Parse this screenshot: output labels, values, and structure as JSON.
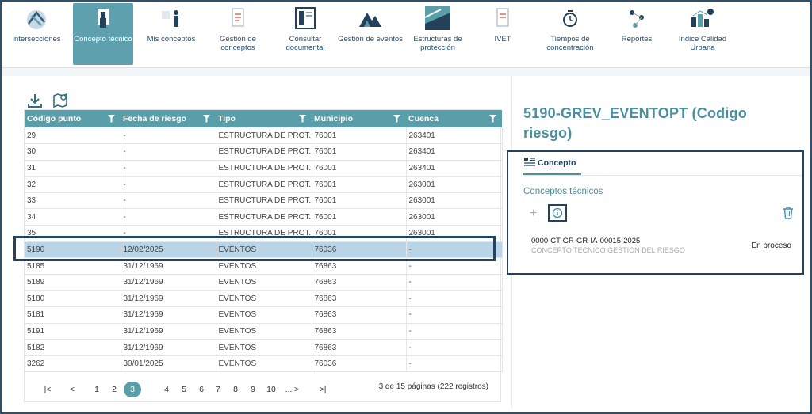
{
  "nav": {
    "items": [
      {
        "label": "Intersecciones",
        "icon": "intersections-icon"
      },
      {
        "label": "Concepto técnico",
        "icon": "technical-concept-icon",
        "active": true
      },
      {
        "label": "Mis conceptos",
        "icon": "my-concepts-icon"
      },
      {
        "label": "Gestión de conceptos",
        "icon": "concept-management-icon"
      },
      {
        "label": "Consultar documental",
        "icon": "document-query-icon"
      },
      {
        "label": "Gestión de eventos",
        "icon": "event-management-icon"
      },
      {
        "label": "Estructuras de protección",
        "icon": "protection-structures-icon"
      },
      {
        "label": "IVET",
        "icon": "ivet-icon"
      },
      {
        "label": "Tiempos de concentración",
        "icon": "concentration-times-icon"
      },
      {
        "label": "Reportes",
        "icon": "reports-icon"
      },
      {
        "label": "Indice Calidad Urbana",
        "icon": "urban-quality-icon"
      }
    ]
  },
  "toolbar": {
    "download_icon": "download-icon",
    "map_icon": "map-edit-icon"
  },
  "table": {
    "columns": [
      "Código punto",
      "Fecha de riesgo",
      "Tipo",
      "Municipio",
      "Cuenca"
    ],
    "rows": [
      [
        "29",
        "-",
        "ESTRUCTURA DE PROT...",
        "76001",
        "263401"
      ],
      [
        "30",
        "-",
        "ESTRUCTURA DE PROT...",
        "76001",
        "263401"
      ],
      [
        "31",
        "-",
        "ESTRUCTURA DE PROT...",
        "76001",
        "263401"
      ],
      [
        "32",
        "-",
        "ESTRUCTURA DE PROT...",
        "76001",
        "263001"
      ],
      [
        "33",
        "-",
        "ESTRUCTURA DE PROT...",
        "76001",
        "263001"
      ],
      [
        "34",
        "-",
        "ESTRUCTURA DE PROT...",
        "76001",
        "263001"
      ],
      [
        "35",
        "-",
        "ESTRUCTURA DE PROT...",
        "76001",
        "263001"
      ],
      [
        "5190",
        "12/02/2025",
        "EVENTOS",
        "76036",
        "-"
      ],
      [
        "5185",
        "31/12/1969",
        "EVENTOS",
        "76863",
        "-"
      ],
      [
        "5189",
        "31/12/1969",
        "EVENTOS",
        "76863",
        "-"
      ],
      [
        "5180",
        "31/12/1969",
        "EVENTOS",
        "76863",
        "-"
      ],
      [
        "5181",
        "31/12/1969",
        "EVENTOS",
        "76863",
        "-"
      ],
      [
        "5191",
        "31/12/1969",
        "EVENTOS",
        "76863",
        "-"
      ],
      [
        "5182",
        "31/12/1969",
        "EVENTOS",
        "76863",
        "-"
      ],
      [
        "3262",
        "30/01/2025",
        "EVENTOS",
        "76036",
        "-"
      ]
    ],
    "selected_row": 7
  },
  "pager": {
    "first": "|<",
    "prev": "<",
    "next": ">",
    "last": ">|",
    "pages": [
      "1",
      "2",
      "3",
      "4",
      "5",
      "6",
      "7",
      "8",
      "9",
      "10",
      "..."
    ],
    "current": "3",
    "info": "3 de 15 páginas (222 registros)"
  },
  "detail": {
    "title": "5190-GREV_EVENTOPT (Codigo riesgo)",
    "tab_label": "Concepto",
    "section_title": "Conceptos técnicos",
    "concept": {
      "code": "0000-CT-GR-GR-IA-00015-2025",
      "description": "CONCEPTO TECNICO GESTION DEL RIESGO",
      "status": "En proceso"
    }
  },
  "colors": {
    "accent": "#5a9ea9",
    "title": "#4a8f9e",
    "selected_row": "#b9d4e6",
    "outline": "#24425d"
  }
}
